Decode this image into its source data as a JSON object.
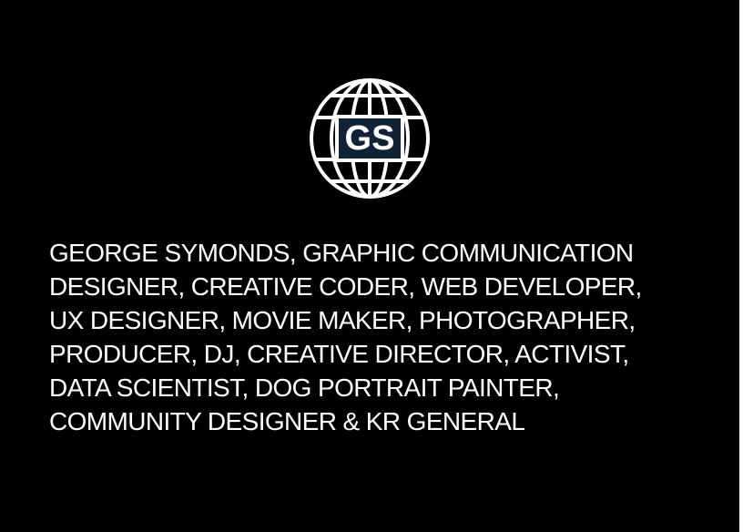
{
  "logo": {
    "initials": "GS",
    "globe_color": "#ffffff",
    "badge_color": "#0f2236",
    "badge_text_color": "#ffffff"
  },
  "bio": {
    "lines": [
      "GEORGE SYMONDS, GRAPHIC COMMUNICATION",
      "DESIGNER, CREATIVE CODER, WEB DEVELOPER,",
      "UX DESIGNER, MOVIE MAKER, PHOTOGRAPHER,",
      "PRODUCER, DJ, CREATIVE DIRECTOR, ACTIVIST,",
      "DATA SCIENTIST, DOG PORTRAIT PAINTER,",
      "COMMUNITY DESIGNER & KR GENERAL"
    ]
  }
}
